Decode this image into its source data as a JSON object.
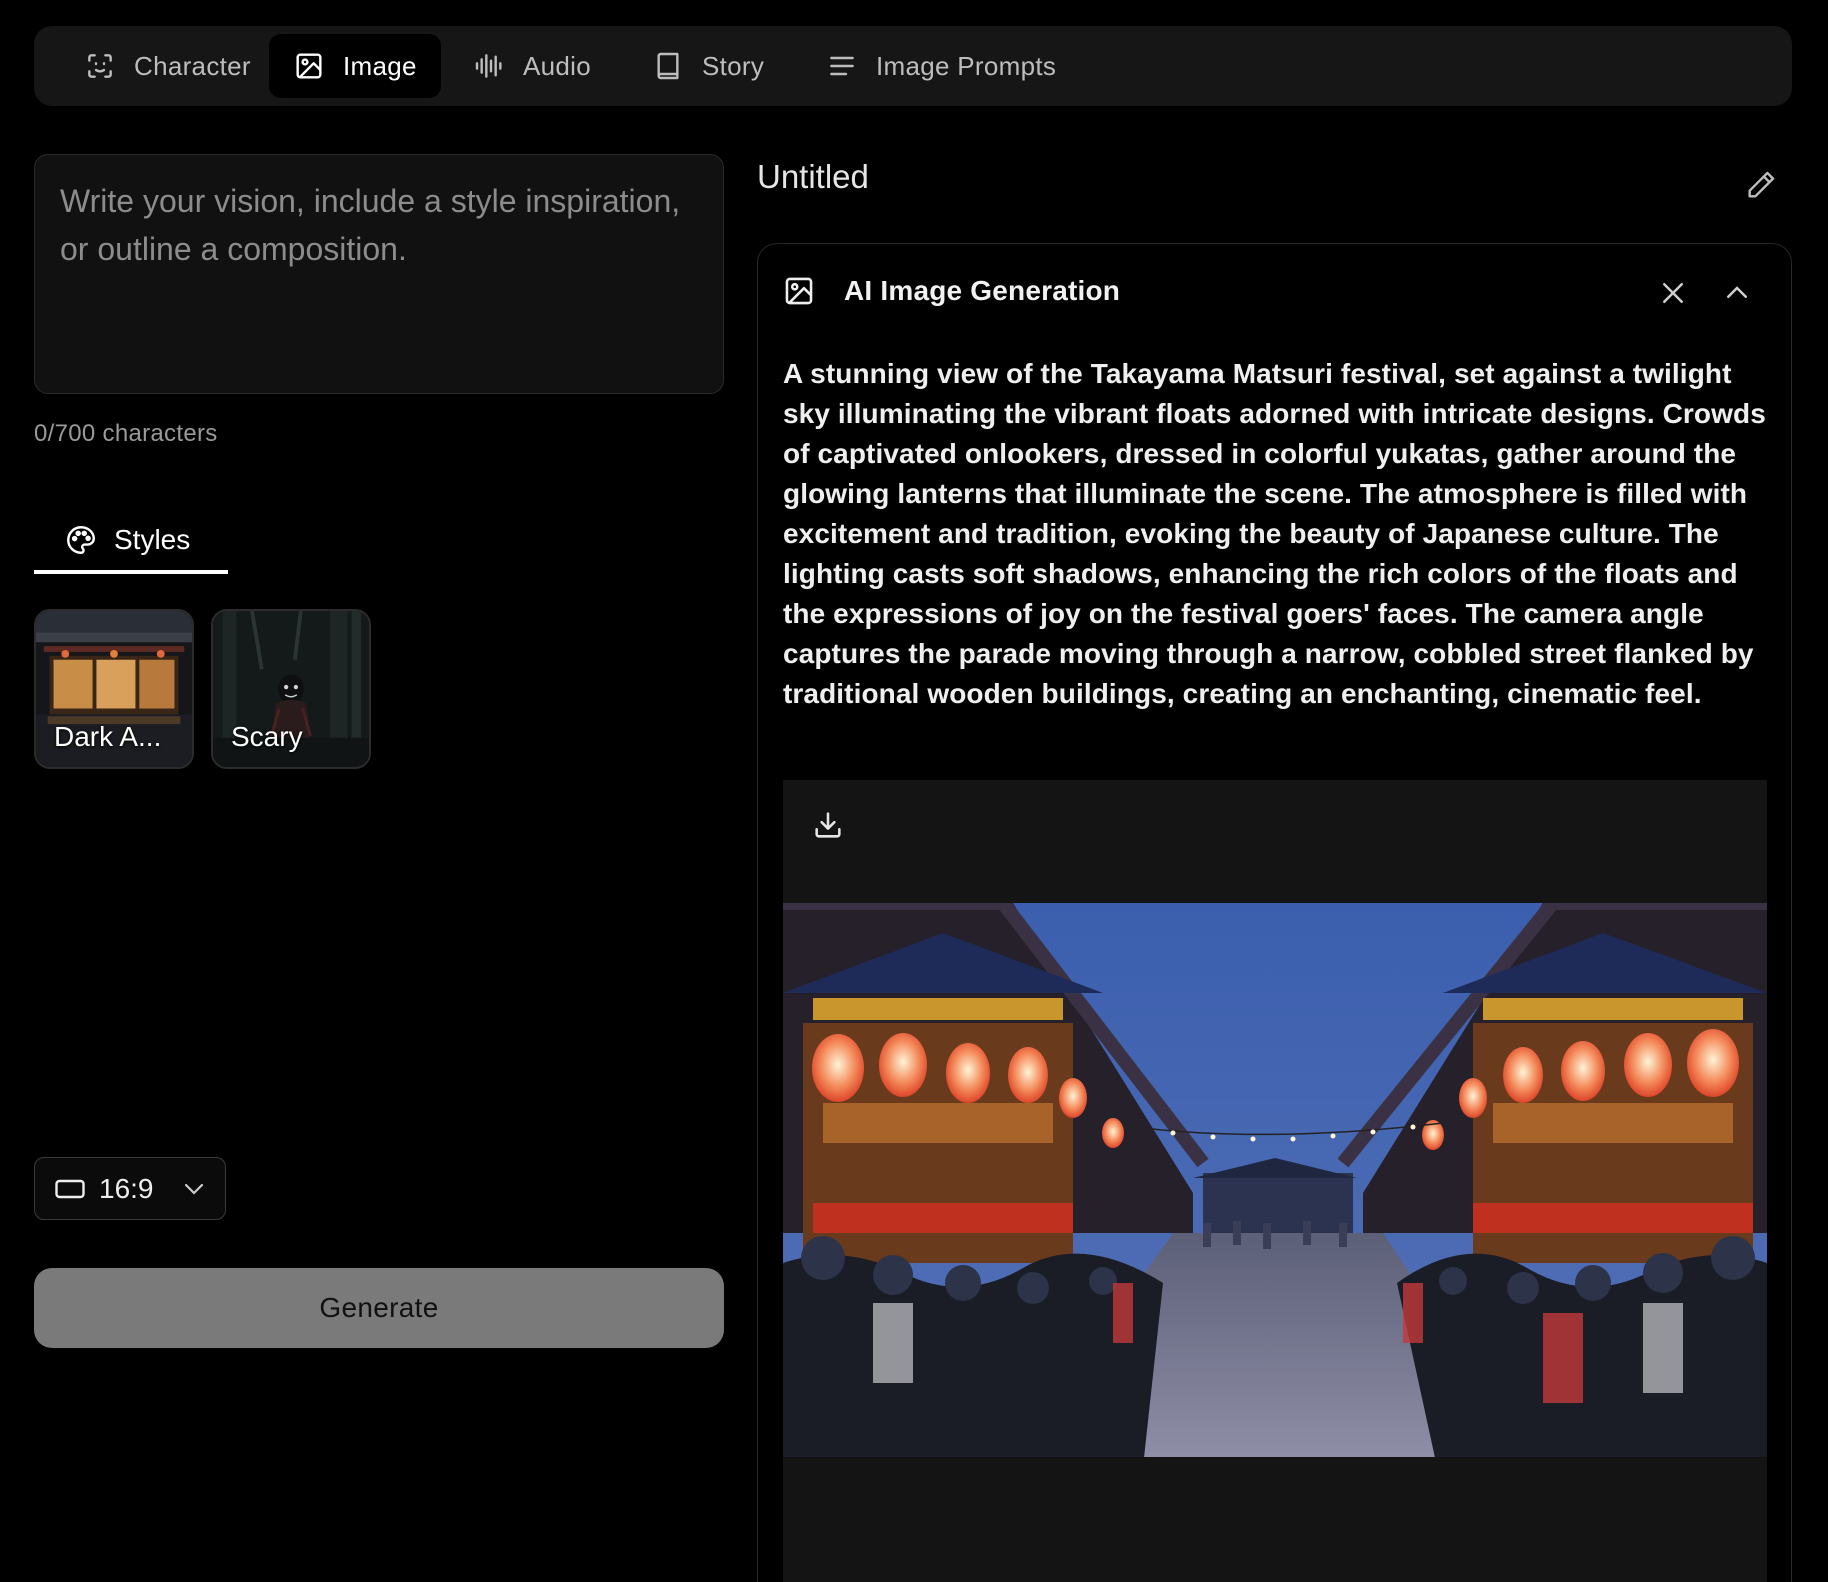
{
  "tabs": [
    {
      "label": "Character",
      "icon": "face-scan-icon"
    },
    {
      "label": "Image",
      "icon": "image-icon",
      "active": true
    },
    {
      "label": "Audio",
      "icon": "waveform-icon"
    },
    {
      "label": "Story",
      "icon": "book-icon"
    },
    {
      "label": "Image Prompts",
      "icon": "lines-icon"
    }
  ],
  "prompt": {
    "placeholder": "Write your vision, include a style inspiration, or outline a composition.",
    "value": "",
    "char_count": "0/700 characters"
  },
  "styles": {
    "tab_label": "Styles",
    "items": [
      {
        "label": "Dark A..."
      },
      {
        "label": "Scary"
      }
    ]
  },
  "aspect_ratio": {
    "value": "16:9"
  },
  "generate_label": "Generate",
  "document": {
    "title": "Untitled"
  },
  "generation": {
    "header": "AI Image Generation",
    "prompt_text": "A stunning view of the Takayama Matsuri festival, set against a twilight sky illuminating the vibrant floats adorned with intricate designs. Crowds of captivated onlookers, dressed in colorful yukatas, gather around the glowing lanterns that illuminate the scene. The atmosphere is filled with excitement and tradition, evoking the beauty of Japanese culture. The lighting casts soft shadows, enhancing the rich colors of the floats and the expressions of joy on the festival goers' faces. The camera angle captures the parade moving through a narrow, cobbled street flanked by traditional wooden buildings, creating an enchanting, cinematic feel."
  },
  "colors": {
    "background": "#000000",
    "panel": "#161616",
    "generate_button": "#7a7a7a"
  }
}
